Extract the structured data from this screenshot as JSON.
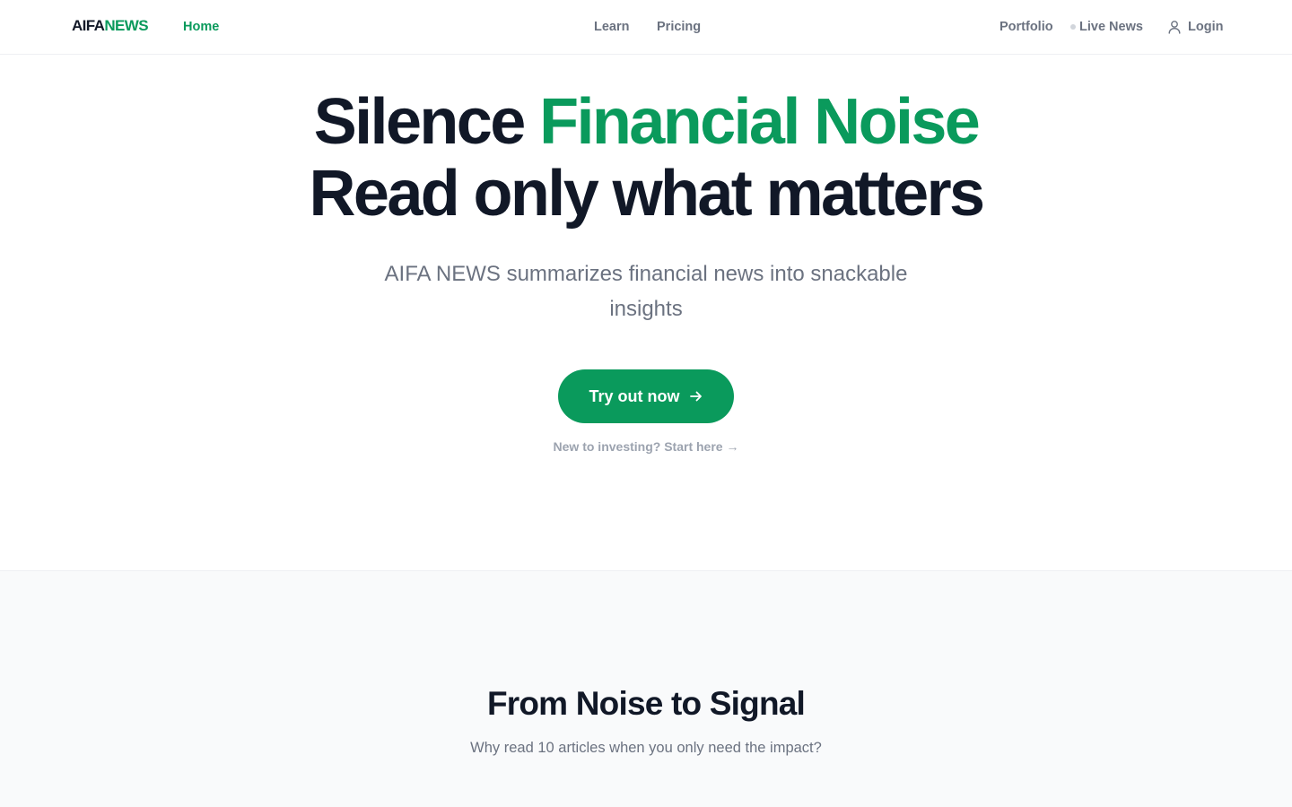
{
  "brand": {
    "part1": "AIFA",
    "part2": "NEWS"
  },
  "nav": {
    "home": "Home",
    "learn": "Learn",
    "pricing": "Pricing",
    "portfolio": "Portfolio",
    "live_news": "Live News",
    "login": "Login"
  },
  "hero": {
    "line1_prefix": "Silence ",
    "line1_accent": "Financial Noise",
    "line2": "Read only what matters",
    "subtitle": "AIFA NEWS summarizes financial news into snackable insights",
    "cta_label": "Try out now",
    "cta_icon": "arrow-right-icon",
    "start_link": "New to investing? Start here →"
  },
  "signal_section": {
    "title": "From Noise to Signal",
    "subtitle": "Why read 10 articles when you only need the impact?"
  },
  "colors": {
    "accent": "#0a9a5c",
    "text_dark": "#111827",
    "text_muted": "#6b7280",
    "section_bg": "#f9fafb"
  }
}
